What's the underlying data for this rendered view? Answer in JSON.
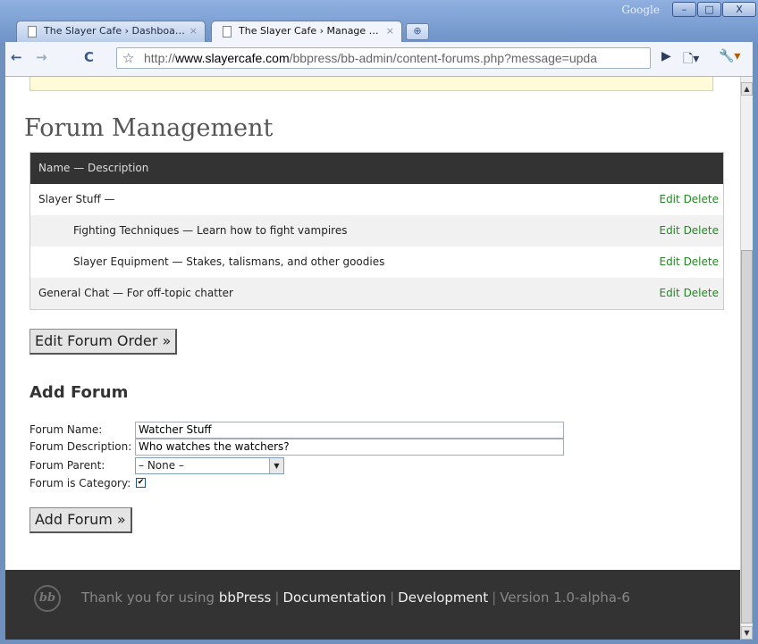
{
  "window": {
    "google_label": "Google",
    "min_icon": "–",
    "max_icon": "□",
    "close_icon": "X"
  },
  "tabs": [
    {
      "title": "The Slayer Cafe › Dashboa…",
      "close": "×"
    },
    {
      "title": "The Slayer Cafe › Manage …",
      "close": "×"
    }
  ],
  "new_tab_icon": "⊕",
  "toolbar": {
    "back": "←",
    "forward": "→",
    "reload": "C",
    "star": "☆",
    "url_prefix": "http://",
    "url_domain": "www.slayercafe.com",
    "url_path": "/bbpress/bb-admin/content-forums.php?message=upda",
    "go_icon": "▶",
    "page_icon": "🗋▾",
    "wrench_icon": "🔧▾"
  },
  "page": {
    "title": "Forum Management",
    "table_header": "Name — Description",
    "forums": [
      {
        "name": "Slayer Stuff —",
        "level": 0,
        "edit": "Edit",
        "delete": "Delete"
      },
      {
        "name": "Fighting Techniques — Learn how to fight vampires",
        "level": 1,
        "edit": "Edit",
        "delete": "Delete"
      },
      {
        "name": "Slayer Equipment — Stakes, talismans, and other goodies",
        "level": 1,
        "edit": "Edit",
        "delete": "Delete"
      },
      {
        "name": "General Chat — For off-topic chatter",
        "level": 0,
        "edit": "Edit",
        "delete": "Delete"
      }
    ],
    "edit_order_button": "Edit Forum Order »",
    "add_section_title": "Add Forum",
    "form": {
      "name_label": "Forum Name:",
      "name_value": "Watcher Stuff",
      "description_label": "Forum Description:",
      "description_value": "Who watches the watchers?",
      "parent_label": "Forum Parent:",
      "parent_value": "– None –",
      "category_label": "Forum is Category:",
      "category_checked": "✔"
    },
    "add_button": "Add Forum »"
  },
  "footer": {
    "logo": "bb",
    "thanks": "Thank you for using",
    "bbpress": "bbPress",
    "documentation": "Documentation",
    "development": "Development",
    "version": "Version 1.0-alpha-6"
  }
}
